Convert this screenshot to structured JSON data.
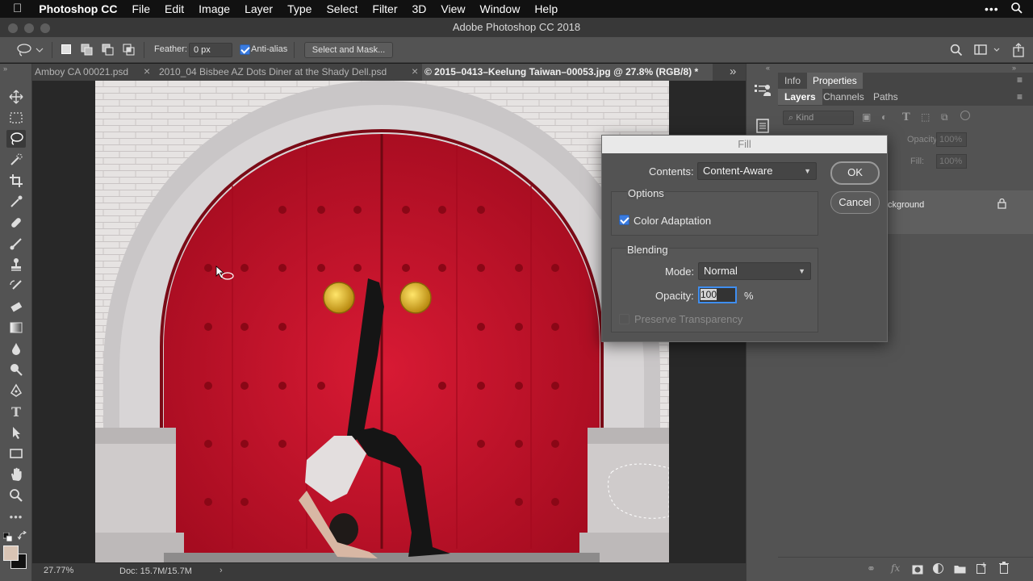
{
  "menubar": {
    "apple": "",
    "app": "Photoshop CC",
    "items": [
      "File",
      "Edit",
      "Image",
      "Layer",
      "Type",
      "Select",
      "Filter",
      "3D",
      "View",
      "Window",
      "Help"
    ]
  },
  "window_title": "Adobe Photoshop CC 2018",
  "options": {
    "feather_label": "Feather:",
    "feather_value": "0 px",
    "antialias_label": "Anti-alias",
    "antialias_checked": true,
    "select_mask_label": "Select and Mask..."
  },
  "tabs": [
    {
      "label": "Amboy CA 00021.psd",
      "active": false
    },
    {
      "label": "2010_04 Bisbee AZ Dots Diner at the Shady Dell.psd",
      "active": false
    },
    {
      "label": "© 2015–0413–Keelung Taiwan–00053.jpg @ 27.8% (RGB/8) *",
      "active": true
    }
  ],
  "tab_close": "×",
  "tabs_overflow": "»",
  "status": {
    "zoom": "27.77%",
    "doc": "Doc: 15.7M/15.7M"
  },
  "panels": {
    "top_tabs": [
      "Info",
      "Properties"
    ],
    "layer_tabs": [
      "Layers",
      "Channels",
      "Paths"
    ],
    "kind_label": "Kind",
    "opacity_label": "Opacity:",
    "opacity_value": "100%",
    "fill_label": "Fill:",
    "fill_value": "100%",
    "layer_name": "Background",
    "layer_name_visible": "ckground"
  },
  "dialog": {
    "title": "Fill",
    "contents_label": "Contents:",
    "contents_value": "Content-Aware",
    "options_title": "Options",
    "color_adaptation": "Color Adaptation",
    "color_adaptation_checked": true,
    "blending_title": "Blending",
    "mode_label": "Mode:",
    "mode_value": "Normal",
    "opacity_label": "Opacity:",
    "opacity_value": "100",
    "opacity_unit": "%",
    "preserve_label": "Preserve Transparency",
    "preserve_checked": false,
    "ok_label": "OK",
    "cancel_label": "Cancel"
  },
  "colors": {
    "door_red": "#c8102e",
    "accent_blue": "#3f8ef0"
  }
}
